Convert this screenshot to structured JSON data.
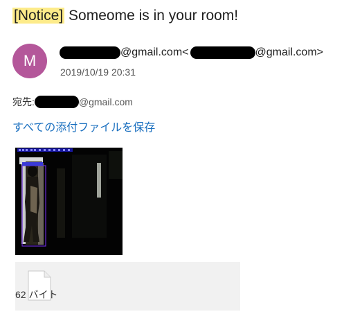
{
  "email": {
    "subject_tag": "[Notice]",
    "subject_text": " Someome is in your room!",
    "avatar_letter": "M",
    "from_domain": "@gmail.com",
    "from_angle_open": " <",
    "from_addr_domain": "@gmail.com>",
    "date": "2019/10/19 20:31",
    "to_label": "宛先: ",
    "to_domain": "@gmail.com"
  },
  "attachments": {
    "save_all_label": "すべての添付ファイルを保存",
    "file_size": "62 バイト"
  },
  "colors": {
    "accent_link": "#1a6fbf",
    "avatar_bg": "#b4579a",
    "highlight": "#fdeb8a",
    "bounding_box": "#6a2bd8"
  },
  "icons": {
    "file": "file-icon"
  }
}
